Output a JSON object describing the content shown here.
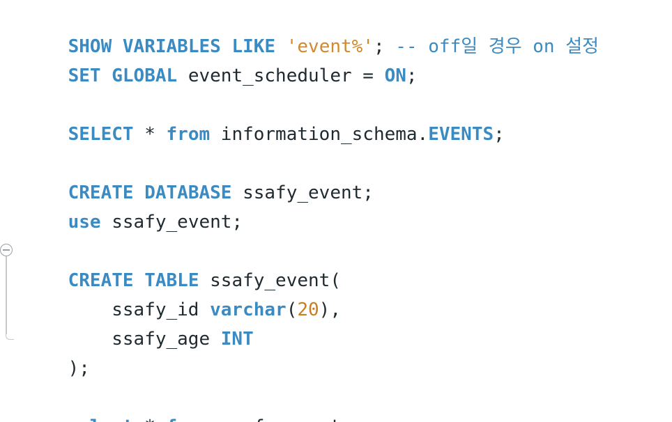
{
  "editor": {
    "lines": [
      {
        "tokens": [
          {
            "t": "kw",
            "v": "SHOW"
          },
          {
            "t": "plain",
            "v": " "
          },
          {
            "t": "kw",
            "v": "VARIABLES"
          },
          {
            "t": "plain",
            "v": " "
          },
          {
            "t": "kw",
            "v": "LIKE"
          },
          {
            "t": "plain",
            "v": " "
          },
          {
            "t": "str",
            "v": "'event%'"
          },
          {
            "t": "plain",
            "v": "; "
          },
          {
            "t": "cmt",
            "v": "-- off일 경우 on 설정"
          }
        ]
      },
      {
        "tokens": [
          {
            "t": "kw",
            "v": "SET"
          },
          {
            "t": "plain",
            "v": " "
          },
          {
            "t": "kw",
            "v": "GLOBAL"
          },
          {
            "t": "plain",
            "v": " event_scheduler = "
          },
          {
            "t": "kw",
            "v": "ON"
          },
          {
            "t": "plain",
            "v": ";"
          }
        ]
      },
      {
        "tokens": [
          {
            "t": "kw",
            "v": "SELECT"
          },
          {
            "t": "plain",
            "v": " * "
          },
          {
            "t": "kw",
            "v": "from"
          },
          {
            "t": "plain",
            "v": " information_schema."
          },
          {
            "t": "kw",
            "v": "EVENTS"
          },
          {
            "t": "plain",
            "v": ";"
          }
        ]
      },
      {
        "tokens": [
          {
            "t": "kw",
            "v": "CREATE"
          },
          {
            "t": "plain",
            "v": " "
          },
          {
            "t": "kw",
            "v": "DATABASE"
          },
          {
            "t": "plain",
            "v": " ssafy_event;"
          }
        ]
      },
      {
        "tokens": [
          {
            "t": "kw",
            "v": "use"
          },
          {
            "t": "plain",
            "v": " ssafy_event;"
          }
        ]
      },
      {
        "tokens": [
          {
            "t": "kw",
            "v": "CREATE"
          },
          {
            "t": "plain",
            "v": " "
          },
          {
            "t": "kw",
            "v": "TABLE"
          },
          {
            "t": "plain",
            "v": " ssafy_event("
          }
        ]
      },
      {
        "tokens": [
          {
            "t": "plain",
            "v": "    ssafy_id "
          },
          {
            "t": "kw",
            "v": "varchar"
          },
          {
            "t": "plain",
            "v": "("
          },
          {
            "t": "num",
            "v": "20"
          },
          {
            "t": "plain",
            "v": "),"
          }
        ]
      },
      {
        "tokens": [
          {
            "t": "plain",
            "v": "    ssafy_age "
          },
          {
            "t": "kw",
            "v": "INT"
          }
        ]
      },
      {
        "tokens": [
          {
            "t": "plain",
            "v": ");"
          }
        ]
      },
      {
        "tokens": [
          {
            "t": "kw",
            "v": "select"
          },
          {
            "t": "plain",
            "v": " * "
          },
          {
            "t": "kw",
            "v": "from"
          },
          {
            "t": "plain",
            "v": " ssafy_event;"
          }
        ]
      }
    ]
  }
}
